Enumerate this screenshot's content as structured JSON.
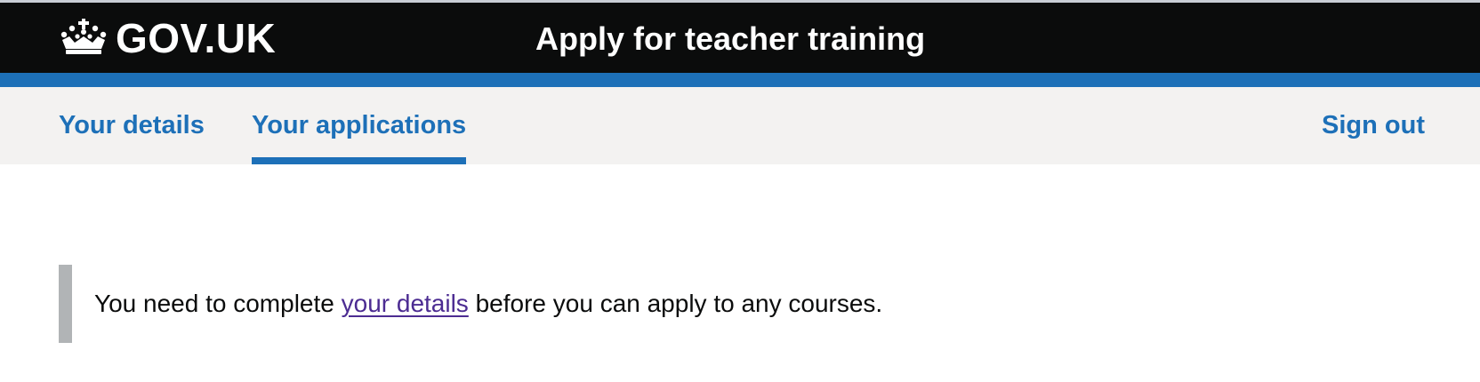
{
  "header": {
    "logo_text": "GOV.UK",
    "service_name": "Apply for teacher training",
    "logo_icon": "crown-icon"
  },
  "nav": {
    "items": [
      {
        "label": "Your details",
        "active": false
      },
      {
        "label": "Your applications",
        "active": true
      }
    ],
    "sign_out": "Sign out"
  },
  "notice": {
    "prefix": "You need to complete ",
    "link_text": "your details",
    "suffix": " before you can apply to any courses."
  },
  "colors": {
    "header_bg": "#0b0c0c",
    "accent_blue": "#1d70b8",
    "nav_bg": "#f3f2f1",
    "visited_link": "#4c2c92",
    "inset_border": "#b1b4b6"
  }
}
